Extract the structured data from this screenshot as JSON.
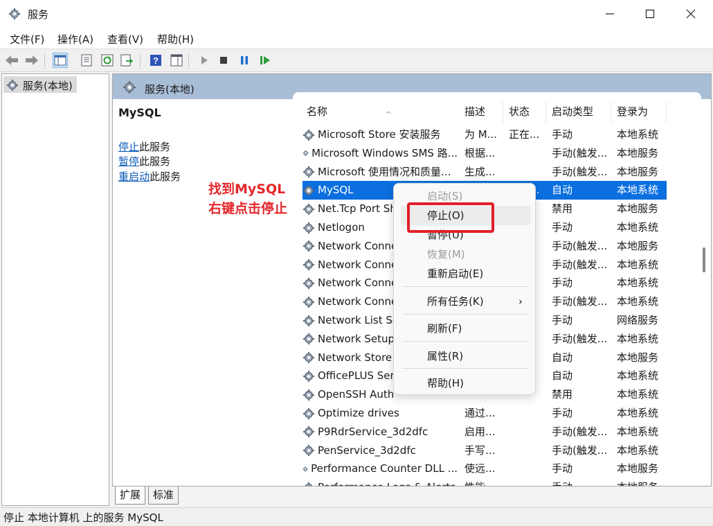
{
  "window": {
    "title": "服务"
  },
  "menubar": [
    "文件(F)",
    "操作(A)",
    "查看(V)",
    "帮助(H)"
  ],
  "toolbar": {
    "icons": [
      "back-arrow-icon",
      "forward-arrow-icon",
      "show-hide-tree-icon",
      "properties-icon",
      "refresh-icon",
      "export-list-icon",
      "help-icon",
      "show-action-pane-icon",
      "start-service-icon",
      "stop-service-icon",
      "pause-service-icon",
      "restart-service-icon"
    ]
  },
  "tree": {
    "root_label": "服务(本地)"
  },
  "right_pane": {
    "header": "服务(本地)",
    "selected_service": "MySQL",
    "actions": [
      {
        "link": "停止",
        "suffix": "此服务"
      },
      {
        "link": "暂停",
        "suffix": "此服务"
      },
      {
        "link": "重启动",
        "suffix": "此服务"
      }
    ],
    "annotation_line1": "找到MySQL",
    "annotation_line2": "右键点击停止"
  },
  "columns": [
    "名称",
    "描述",
    "状态",
    "启动类型",
    "登录为"
  ],
  "services": [
    {
      "name": "Microsoft Store 安装服务",
      "desc": "为 M...",
      "status": "正在...",
      "start": "手动",
      "logon": "本地系统"
    },
    {
      "name": "Microsoft Windows SMS 路...",
      "desc": "根据...",
      "status": "",
      "start": "手动(触发...",
      "logon": "本地服务"
    },
    {
      "name": "Microsoft 使用情况和质量...",
      "desc": "生成...",
      "status": "",
      "start": "手动(触发...",
      "logon": "本地服务"
    },
    {
      "name": "MySQL",
      "desc": "",
      "status": "正在...",
      "start": "自动",
      "logon": "本地系统",
      "selected": true
    },
    {
      "name": "Net.Tcp Port Sh",
      "desc": "",
      "status": "",
      "start": "禁用",
      "logon": "本地服务"
    },
    {
      "name": "Netlogon",
      "desc": "",
      "status": "",
      "start": "手动",
      "logon": "本地系统"
    },
    {
      "name": "Network Conne",
      "desc": "",
      "status": "",
      "start": "手动(触发...",
      "logon": "本地服务"
    },
    {
      "name": "Network Conne",
      "desc": "",
      "status": "",
      "start": "手动(触发...",
      "logon": "本地系统"
    },
    {
      "name": "Network Conne",
      "desc": "",
      "status": "",
      "start": "手动",
      "logon": "本地系统"
    },
    {
      "name": "Network Conne",
      "desc": "",
      "status": "",
      "start": "手动(触发...",
      "logon": "本地系统"
    },
    {
      "name": "Network List Se",
      "desc": "",
      "status": "",
      "start": "手动",
      "logon": "网络服务"
    },
    {
      "name": "Network Setup",
      "desc": "",
      "status": "",
      "start": "手动(触发...",
      "logon": "本地系统"
    },
    {
      "name": "Network Store",
      "desc": "",
      "status": "",
      "start": "自动",
      "logon": "本地服务"
    },
    {
      "name": "OfficePLUS Ser",
      "desc": "",
      "status": "",
      "start": "自动",
      "logon": "本地系统"
    },
    {
      "name": "OpenSSH Auth",
      "desc": "",
      "status": "",
      "start": "禁用",
      "logon": "本地系统"
    },
    {
      "name": "Optimize drives",
      "desc": "通过...",
      "status": "",
      "start": "手动",
      "logon": "本地系统"
    },
    {
      "name": "P9RdrService_3d2dfc",
      "desc": "启用...",
      "status": "",
      "start": "手动(触发...",
      "logon": "本地系统"
    },
    {
      "name": "PenService_3d2dfc",
      "desc": "手写...",
      "status": "",
      "start": "手动(触发...",
      "logon": "本地系统"
    },
    {
      "name": "Performance Counter DLL ...",
      "desc": "使远...",
      "status": "",
      "start": "手动",
      "logon": "本地服务"
    },
    {
      "name": "Performance Logs & Alerts",
      "desc": "性能...",
      "status": "",
      "start": "手动",
      "logon": "本地服务"
    }
  ],
  "context_menu": {
    "items": [
      {
        "label": "启动(S)",
        "disabled": true
      },
      {
        "label": "停止(O)",
        "disabled": false
      },
      {
        "label": "暂停(U)",
        "disabled": false
      },
      {
        "label": "恢复(M)",
        "disabled": true
      },
      {
        "label": "重新启动(E)",
        "disabled": false
      },
      {
        "label": "所有任务(K)",
        "disabled": false
      },
      {
        "label": "刷新(F)",
        "disabled": false
      },
      {
        "label": "属性(R)",
        "disabled": false
      },
      {
        "label": "帮助(H)",
        "disabled": false
      }
    ],
    "submenu_arrow": "›"
  },
  "tabs": [
    "扩展",
    "标准"
  ],
  "statusbar": "停止 本地计算机 上的服务 MySQL",
  "colors": {
    "selection": "#0b6fe0",
    "link": "#0b5ab9",
    "annotation": "#e5262a",
    "header_band": "#a8bdd6"
  }
}
